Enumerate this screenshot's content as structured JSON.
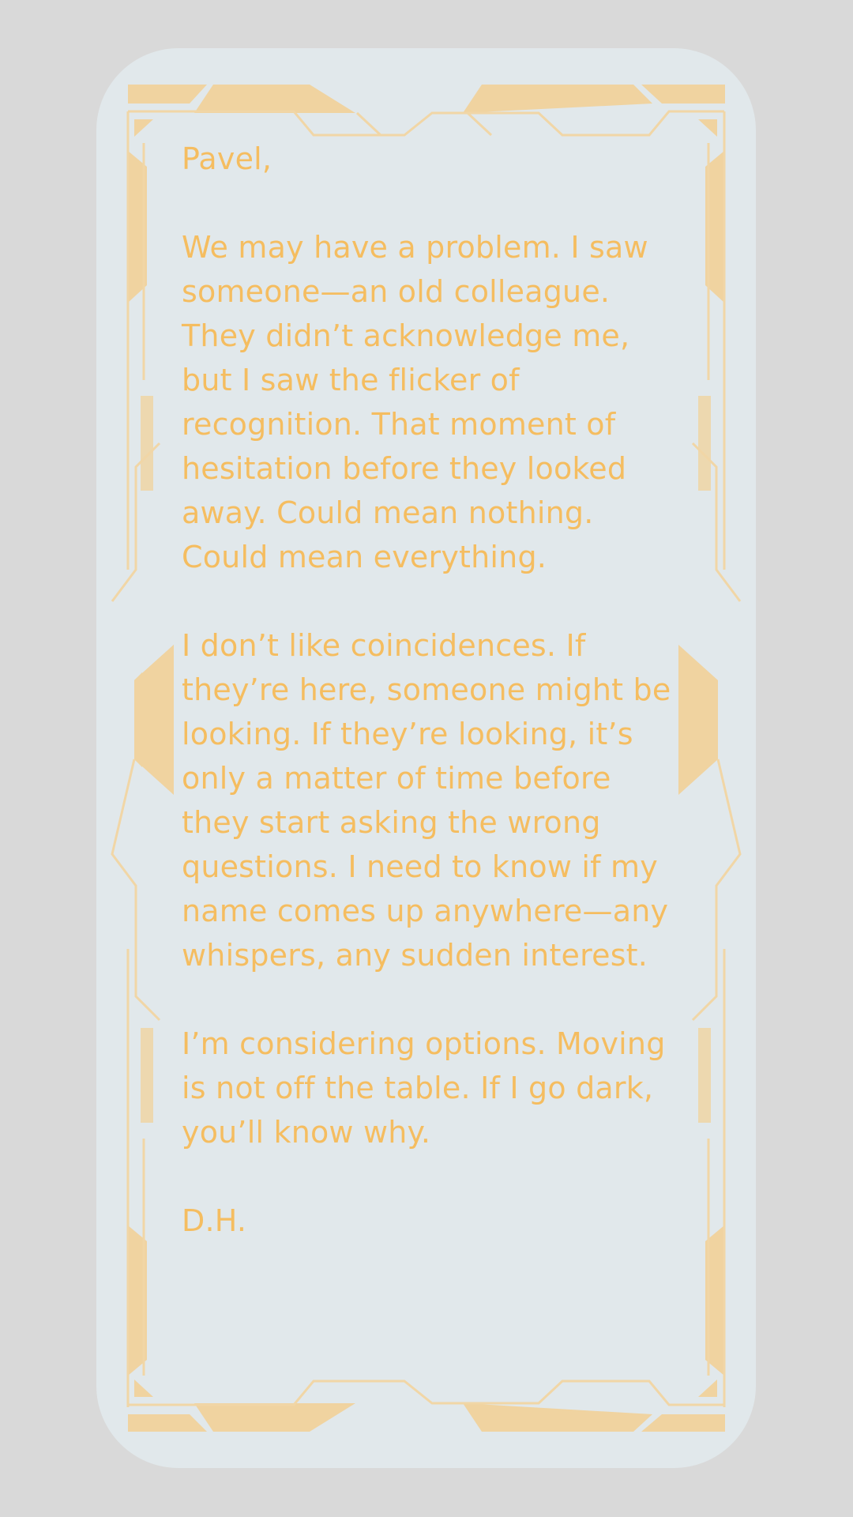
{
  "letter": {
    "salutation": "Pavel,",
    "paragraphs": [
      "We may have a problem. I saw someone—an old colleague. They didn’t acknowledge me, but I saw the flicker of recognition. That moment of hesitation before they looked away. Could mean nothing. Could mean everything.",
      "I don’t like coincidences. If they’re here, someone might be looking. If they’re looking, it’s only a matter of time before they start asking the wrong questions. I need to know if my name comes up anywhere—any whispers, any sudden interest.",
      "I’m considering options. Moving is not off the table. If I go dark, you’ll know why."
    ],
    "signature": "D.H."
  },
  "colors": {
    "page_background": "#d9d9d9",
    "card_background": "#e1e8eb",
    "text": "#f5bd60",
    "frame_fill": "#f0d3a0",
    "frame_line": "#f1d6a6"
  },
  "icons": {
    "frame": "sci-fi-ornamental-border"
  }
}
